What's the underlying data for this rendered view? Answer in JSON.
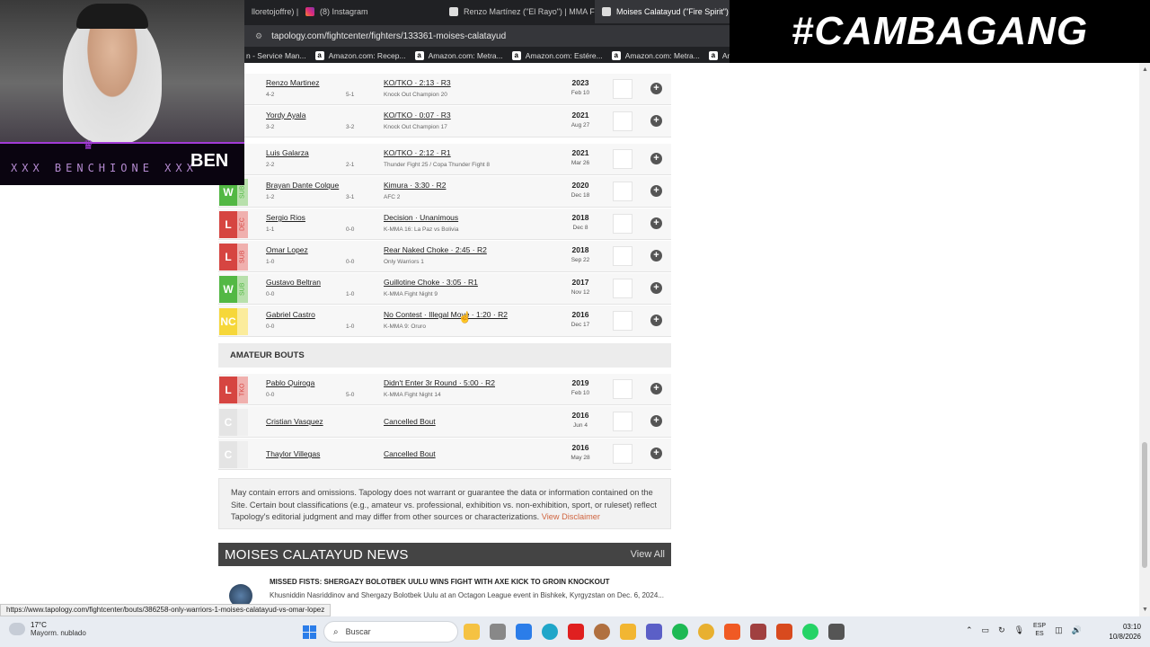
{
  "browser": {
    "tabs": [
      {
        "label": "lloretojoffre) |",
        "active": false
      },
      {
        "label": "(8) Instagram",
        "active": false,
        "icon": "instagram-icon"
      },
      {
        "label": "Renzo Martínez (\"El Rayo\") | MMA Fig",
        "active": false,
        "icon": "tapology-icon"
      },
      {
        "label": "Moises Calatayud (\"Fire Spirit\") |",
        "active": true,
        "icon": "tapology-icon"
      }
    ],
    "url": "tapology.com/fightcenter/fighters/133361-moises-calatayud",
    "bookmarks": [
      {
        "label": "n - Service Man...",
        "icon": ""
      },
      {
        "label": "Amazon.com: Recep...",
        "icon": "a"
      },
      {
        "label": "Amazon.com: Metra...",
        "icon": "a"
      },
      {
        "label": "Amazon.com: Estére...",
        "icon": "a"
      },
      {
        "label": "Amazon.com: Metra...",
        "icon": "a"
      },
      {
        "label": "Amazon.com",
        "icon": "a"
      }
    ]
  },
  "overlay": {
    "hashtag": "#CAMBAGANG",
    "streamer_name": "XXX BENCHIONE XXX",
    "logo": "BEN"
  },
  "pro_bouts": [
    {
      "result": "",
      "method_tag": "",
      "opponent": "Renzo Martinez",
      "record": "4-2",
      "opp_record": "5-1",
      "method": "KO/TKO · 2:13 · R3",
      "event": "Knock Out Champion 20",
      "year": "2023",
      "date": "Feb 10",
      "colors": {
        "res": "#53b844"
      }
    },
    {
      "result": "",
      "method_tag": "",
      "opponent": "Yordy Ayala",
      "record": "3-2",
      "opp_record": "3-2",
      "method": "KO/TKO · 0:07 · R3",
      "event": "Knock Out Champion 17",
      "year": "2021",
      "date": "Aug 27"
    },
    {
      "result": "",
      "method_tag": "",
      "opponent": "Luis Galarza",
      "record": "2-2",
      "opp_record": "2-1",
      "method": "KO/TKO · 2:12 · R1",
      "event": "Thunder Fight 25 / Copa Thunder Fight 8",
      "year": "2021",
      "date": "Mar 26"
    },
    {
      "result": "W",
      "method_tag": "SUB",
      "opponent": "Brayan Dante Colque",
      "record": "1-2",
      "opp_record": "3-1",
      "method": "Kimura · 3:30 · R2",
      "event": "AFC 2",
      "year": "2020",
      "date": "Dec 18"
    },
    {
      "result": "L",
      "method_tag": "DEC",
      "opponent": "Sergio Rios",
      "record": "1-1",
      "opp_record": "0-0",
      "method": "Decision · Unanimous",
      "event": "K-MMA 16: La Paz vs Bolivia",
      "year": "2018",
      "date": "Dec 8"
    },
    {
      "result": "L",
      "method_tag": "SUB",
      "opponent": "Omar Lopez",
      "record": "1-0",
      "opp_record": "0-0",
      "method": "Rear Naked Choke · 2:45 · R2",
      "event": "Only Warriors 1",
      "year": "2018",
      "date": "Sep 22"
    },
    {
      "result": "W",
      "method_tag": "SUB",
      "opponent": "Gustavo Beltran",
      "record": "0-0",
      "opp_record": "1-0",
      "method": "Guillotine Choke · 3:05 · R1",
      "event": "K-MMA Fight Night 9",
      "year": "2017",
      "date": "Nov 12"
    },
    {
      "result": "NC",
      "method_tag": "",
      "opponent": "Gabriel Castro",
      "record": "0-0",
      "opp_record": "1-0",
      "method": "No Contest · Illegal Move · 1:20 · R2",
      "event": "K-MMA 9: Oruro",
      "year": "2016",
      "date": "Dec 17"
    }
  ],
  "amateur_heading": "AMATEUR BOUTS",
  "amateur_bouts": [
    {
      "result": "L",
      "method_tag": "TKO",
      "opponent": "Pablo Quiroga",
      "record": "0-0",
      "opp_record": "5-0",
      "method": "Didn't Enter 3r Round · 5:00 · R2",
      "event": "K-MMA Fight Night 14",
      "year": "2019",
      "date": "Feb 10"
    },
    {
      "result": "C",
      "method_tag": "",
      "opponent": "Cristian Vasquez",
      "record": "",
      "opp_record": "",
      "method": "Cancelled Bout",
      "event": "",
      "year": "2016",
      "date": "Jun 4"
    },
    {
      "result": "C",
      "method_tag": "",
      "opponent": "Thaylor Villegas",
      "record": "",
      "opp_record": "",
      "method": "Cancelled Bout",
      "event": "",
      "year": "2016",
      "date": "May 28"
    }
  ],
  "disclaimer": {
    "text": "May contain errors and omissions. Tapology does not warrant or guarantee the data or information contained on the Site. Certain bout classifications (e.g., amateur vs. professional, exhibition vs. non-exhibition, sport, or ruleset) reflect Tapology's editorial judgment and may differ from other sources or characterizations.",
    "link": "View Disclaimer"
  },
  "news": {
    "title": "MOISES CALATAYUD NEWS",
    "view_all": "View All",
    "item_title": "MISSED FISTS: SHERGAZY BOLOTBEK UULU WINS FIGHT WITH AXE KICK TO GROIN KNOCKOUT",
    "item_snippet": "Khusniddin Nasriddinov and Shergazy Bolotbek Uulu at an Octagon League event in Bishkek, Kyrgyzstan on Dec. 6, 2024..."
  },
  "status_url": "https://www.tapology.com/fightcenter/bouts/386258-only-warriors-1-moises-calatayud-vs-omar-lopez",
  "taskbar": {
    "temp": "17°C",
    "weather": "Mayorm. nublado",
    "search": "Buscar",
    "lang1": "ESP",
    "lang2": "ES",
    "time": "03:10",
    "date": "10/8/2026"
  }
}
